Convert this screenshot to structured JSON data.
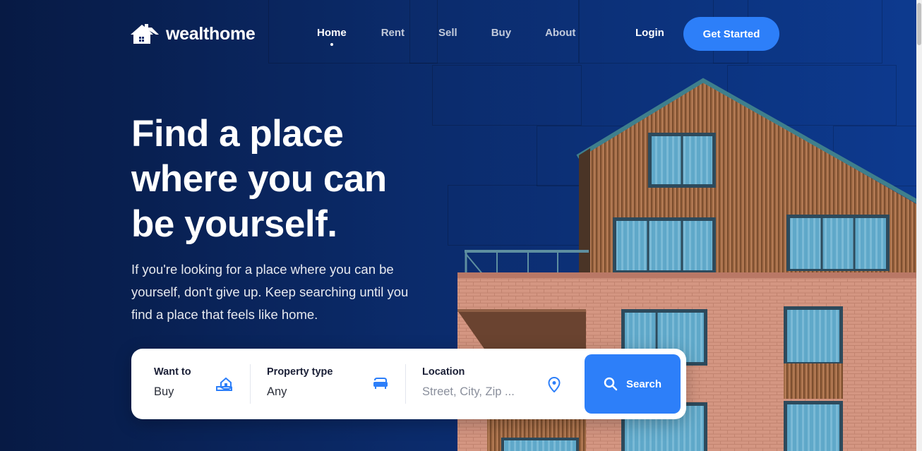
{
  "brand": {
    "name": "wealthome",
    "icon": "house-logo-icon"
  },
  "nav": {
    "items": [
      {
        "label": "Home",
        "active": true
      },
      {
        "label": "Rent",
        "active": false
      },
      {
        "label": "Sell",
        "active": false
      },
      {
        "label": "Buy",
        "active": false
      },
      {
        "label": "About",
        "active": false
      }
    ],
    "login_label": "Login",
    "cta_label": "Get Started"
  },
  "hero": {
    "headline_lines": [
      "Find a place",
      "where you can",
      "be yourself."
    ],
    "subtext_lines": [
      "If you're looking for a place where you can be",
      "yourself, don't give up. Keep searching until you",
      "find a place that feels like home."
    ]
  },
  "search": {
    "want_to": {
      "label": "Want to",
      "value": "Buy",
      "icon": "house-hand-icon"
    },
    "property_type": {
      "label": "Property type",
      "value": "Any",
      "icon": "sofa-icon"
    },
    "location": {
      "label": "Location",
      "placeholder": "Street, City, Zip ...",
      "icon": "map-pin-icon"
    },
    "button_label": "Search",
    "button_icon": "search-icon"
  },
  "colors": {
    "accent": "#2d7ff9",
    "background_dark": "#071a44",
    "background_blue": "#0d3a8f"
  }
}
